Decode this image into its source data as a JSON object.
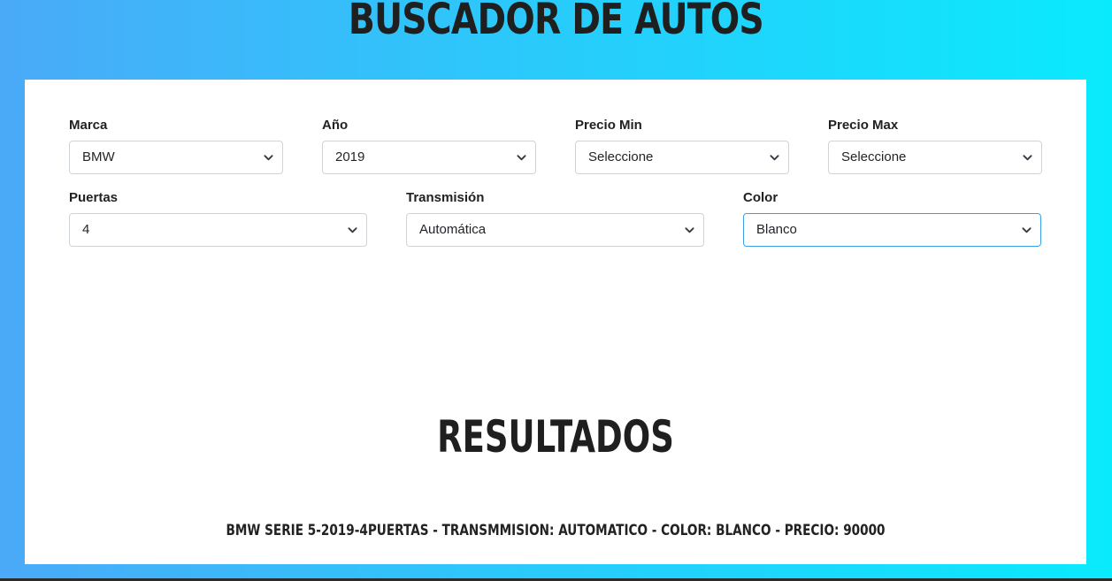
{
  "header": {
    "title": "Buscador de Autos"
  },
  "filters": {
    "marca": {
      "label": "Marca",
      "value": "BMW"
    },
    "year": {
      "label": "Año",
      "value": "2019"
    },
    "precio_min": {
      "label": "Precio Min",
      "value": "Seleccione"
    },
    "precio_max": {
      "label": "Precio Max",
      "value": "Seleccione"
    },
    "puertas": {
      "label": "Puertas",
      "value": "4"
    },
    "transmision": {
      "label": "Transmisión",
      "value": "Automática"
    },
    "color": {
      "label": "Color",
      "value": "Blanco"
    }
  },
  "results": {
    "title": "Resultados",
    "items": [
      "BMW Serie 5-2019-4Puertas - Transmmision: Automatico - Color: Blanco - Precio: 90000"
    ]
  },
  "icons": {
    "dropdown": "chevron-down-icon"
  },
  "colors": {
    "background_start": "#4aaaf8",
    "background_end": "#0aeafd",
    "card": "#ffffff",
    "focus_border": "#3aa0ea",
    "text": "#1f1f1f"
  }
}
